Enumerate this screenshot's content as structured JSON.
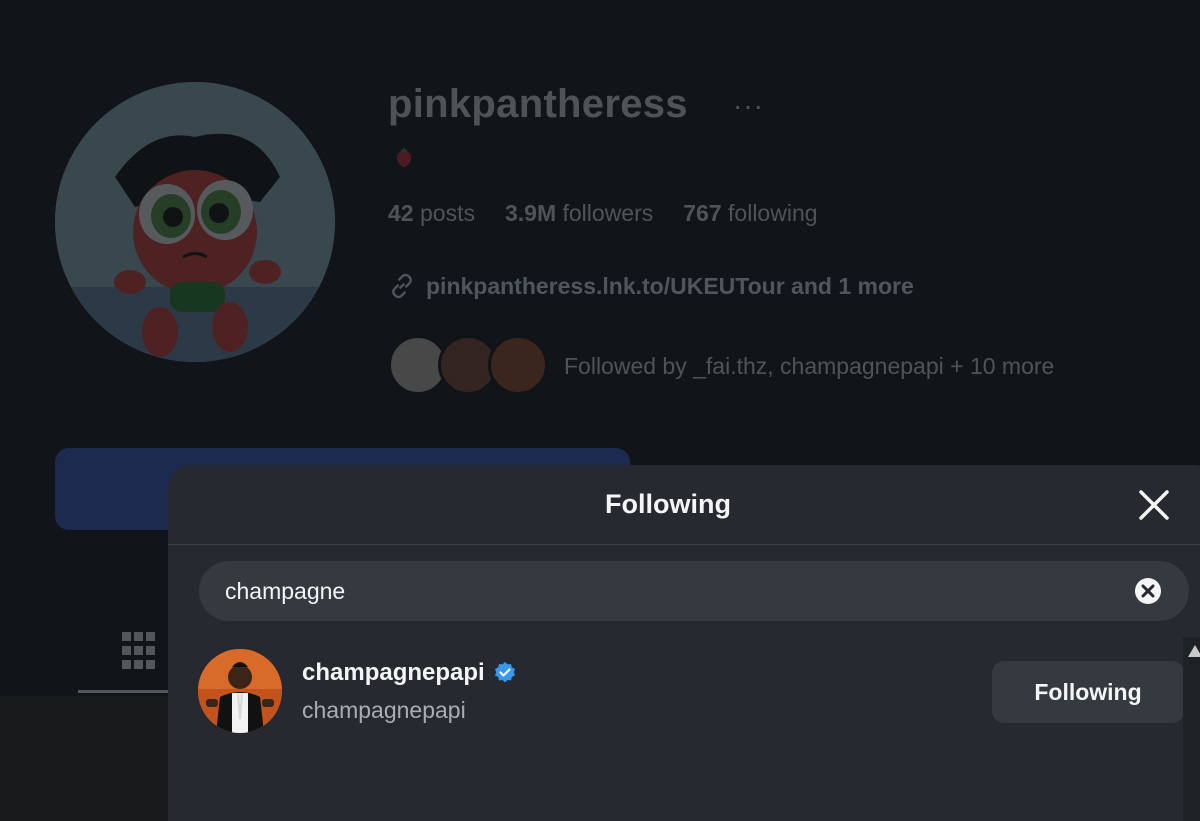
{
  "profile": {
    "username": "pinkpantheress",
    "more_icon": "more-dots-icon",
    "bio_icon": "strawberry-icon",
    "stats": {
      "posts": {
        "count": "42",
        "label": "posts"
      },
      "followers": {
        "count": "3.9M",
        "label": "followers"
      },
      "following": {
        "count": "767",
        "label": "following"
      }
    },
    "link_text": "pinkpantheress.lnk.to/UKEUTour and 1 more",
    "link_icon": "link-icon",
    "followed_by": "Followed by _fai.thz, champagnepapi + 10 more"
  },
  "modal": {
    "title": "Following",
    "close_icon": "close-icon",
    "search": {
      "value": "champagne",
      "clear_icon": "clear-icon"
    },
    "results": [
      {
        "name": "champagnepapi",
        "handle": "champagnepapi",
        "verified": true,
        "button_label": "Following"
      }
    ]
  },
  "colors": {
    "background": "#111418",
    "modal": "#262a30",
    "input": "#353a41",
    "verified": "#3897f0",
    "follow_button": "#3a5fd8"
  }
}
